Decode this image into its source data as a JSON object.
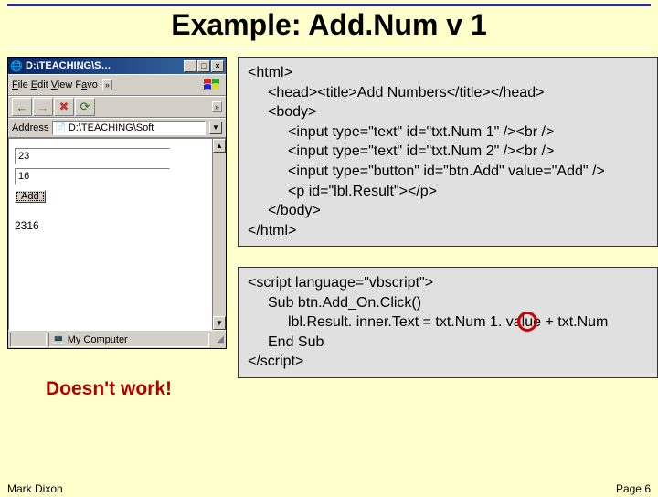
{
  "slide": {
    "title": "Example: Add.Num v 1"
  },
  "browser": {
    "title": "D:\\TEACHING\\S…",
    "minimize": "_",
    "maximize": "□",
    "close": "×",
    "menu": {
      "file": "File",
      "edit": "Edit",
      "view": "View",
      "favo": "Favo",
      "chev": "»"
    },
    "toolbar": {
      "back": "←",
      "forward": "→",
      "stop": "✖",
      "refresh": "⟳",
      "chev": "»"
    },
    "address": {
      "label": "Address",
      "value": "D:\\TEACHING\\Soft"
    },
    "viewport": {
      "num1": "23",
      "num2": "16",
      "add": "Add",
      "result": "2316"
    },
    "status": {
      "text": "My Computer"
    }
  },
  "code1": {
    "l1": "<html>",
    "l2": "<head><title>Add Numbers</title></head>",
    "l3": "<body>",
    "l4": "<input type=\"text\" id=\"txt.Num 1\" /><br />",
    "l5": "<input type=\"text\" id=\"txt.Num 2\" /><br />",
    "l6": "<input type=\"button\" id=\"btn.Add\" value=\"Add\" />",
    "l7": "<p id=\"lbl.Result\"></p>",
    "l8": "</body>",
    "l9": "</html>"
  },
  "code2": {
    "l1": "<script language=\"vbscript\">",
    "l2": "Sub btn.Add_On.Click()",
    "l3": "lbl.Result. inner.Text = txt.Num 1. value + txt.Num",
    "l4": "End Sub",
    "l5": "</scr"
  },
  "code2_close": "ipt>",
  "note": "Doesn't work!",
  "footer": {
    "author": "Mark Dixon",
    "page": "Page 6"
  }
}
